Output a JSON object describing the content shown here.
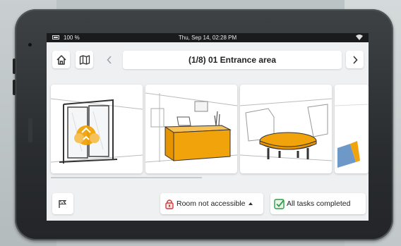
{
  "status": {
    "battery": "100 %",
    "datetime": "Thu, Sep 14, 02:28 PM"
  },
  "nav": {
    "title": "(1/8) 01 Entrance area",
    "icons": {
      "home": "home-icon",
      "map": "map-icon",
      "prev": "chevron-left-icon",
      "next": "chevron-right-icon"
    }
  },
  "cards": [
    {
      "name": "entrance-doors-card",
      "icon": "sliding-doors-illustration"
    },
    {
      "name": "reception-desk-card",
      "icon": "reception-desk-illustration"
    },
    {
      "name": "lounge-table-card",
      "icon": "coffee-table-illustration"
    },
    {
      "name": "partial-card",
      "icon": "partial-illustration"
    }
  ],
  "bottom": {
    "flag_icon": "flag-icon",
    "room_status": "Room not accessible",
    "room_status_icon": "lock-icon",
    "tasks_status": "All tasks completed",
    "tasks_icon": "checkbox-icon"
  },
  "colors": {
    "accent": "#f0a30a",
    "lock_red": "#d23b3b",
    "check_green": "#2f9e44",
    "title_text": "#222222"
  }
}
